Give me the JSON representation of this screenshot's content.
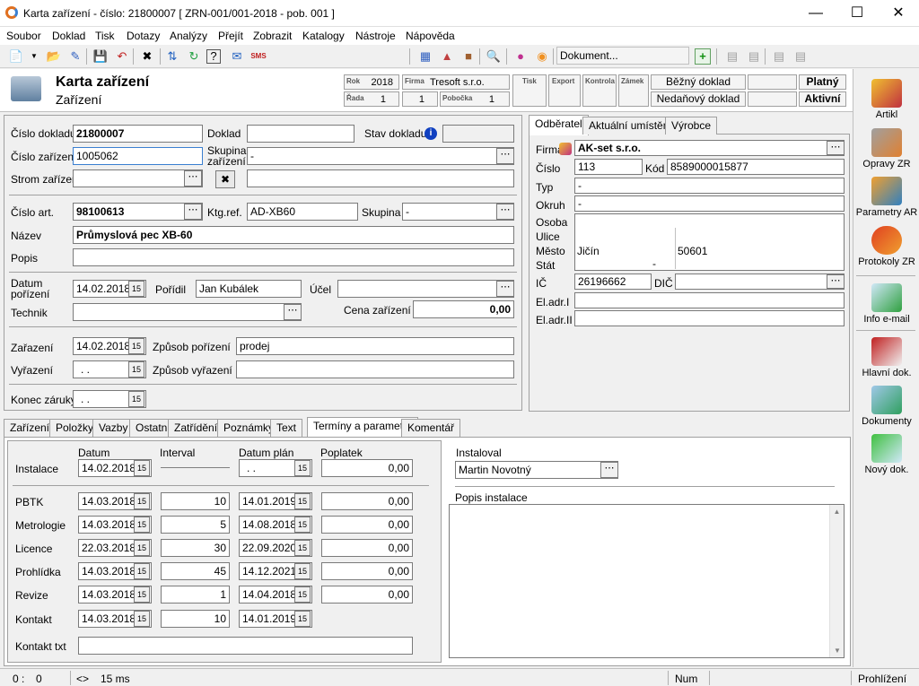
{
  "window": {
    "title": "Karta zařízení - číslo: 21800007  [ ZRN-001/001-2018 - pob. 001 ]"
  },
  "menu": [
    "Soubor",
    "Doklad",
    "Tisk",
    "Dotazy",
    "Analýzy",
    "Přejít",
    "Zobrazit",
    "Katalogy",
    "Nástroje",
    "Nápověda"
  ],
  "toolbar": {
    "document_field": "Dokument..."
  },
  "header": {
    "title": "Karta zařízení",
    "subtitle": "Zařízení",
    "rok_label": "Rok",
    "rok": "2018",
    "firma_label": "Firma",
    "firma": "Tresoft s.r.o.",
    "rada_label": "Řada",
    "rada": "1",
    "num1": "1",
    "pobocka_label": "Pobočka",
    "pobocka": "1",
    "tisk_label": "Tisk",
    "export_label": "Export",
    "kontrola_label": "Kontrola",
    "zamek_label": "Zámek",
    "doc_type1": "Běžný doklad",
    "doc_type2": "Nedaňový doklad",
    "status1": "Platný",
    "status2": "Aktivní"
  },
  "form": {
    "cislo_dokladu_label": "Číslo dokladu",
    "cislo_dokladu": "21800007",
    "doklad_label": "Doklad",
    "stav_dokladu_label": "Stav dokladu",
    "cislo_zarizeni_label": "Číslo zařízení",
    "cislo_zarizeni": "1005062",
    "skupina_zarizeni_label1": "Skupina",
    "skupina_zarizeni_label2": "zařízení",
    "skupina_zarizeni": "-",
    "strom_label": "Strom zařízení",
    "cislo_art_label": "Číslo art.",
    "cislo_art": "98100613",
    "ktg_label": "Ktg.ref.",
    "ktg": "AD-XB60",
    "skupina_label": "Skupina",
    "skupina": "-",
    "nazev_label": "Název",
    "nazev": "Průmyslová pec XB-60",
    "popis_label": "Popis",
    "datum_porizeni_label1": "Datum",
    "datum_porizeni_label2": "pořízení",
    "datum_porizeni": "14.02.2018",
    "poridil_label": "Pořídil",
    "poridil": "Jan Kubálek",
    "ucel_label": "Účel",
    "technik_label": "Technik",
    "cena_label": "Cena zařízení",
    "cena": "0,00",
    "zarazeni_label": "Zařazení",
    "zarazeni": "14.02.2018",
    "zpusob_porizeni_label": "Způsob pořízení",
    "zpusob_porizeni": "prodej",
    "vyrazeni_label": "Vyřazení",
    "vyrazeni": ". .",
    "zpusob_vyrazeni_label": "Způsob vyřazení",
    "konec_zaruky_label": "Konec záruky",
    "konec_zaruky": ". ."
  },
  "right_tabs": [
    "Odběratel",
    "Aktuální umístění",
    "Výrobce"
  ],
  "odberatel": {
    "firma_label": "Firma",
    "firma": "AK-set s.r.o.",
    "cislo_label": "Číslo",
    "cislo": "113",
    "kod_label": "Kód",
    "kod": "8589000015877",
    "typ_label": "Typ",
    "typ": "-",
    "okruh_label": "Okruh",
    "okruh": "-",
    "osoba_label": "Osoba",
    "ulice_label": "Ulice",
    "mesto_label": "Město",
    "mesto": "Jičín",
    "psc": "50601",
    "stat_label": "Stát",
    "stat": "-",
    "ic_label": "IČ",
    "ic": "26196662",
    "dic_label": "DIČ",
    "eladr1_label": "El.adr.I",
    "eladr2_label": "El.adr.II"
  },
  "bottom_tabs": [
    "Zařízení",
    "Položky",
    "Vazby",
    "Ostatní",
    "Zatřídění",
    "Poznámky",
    "Text",
    "Termíny a parametry",
    "Komentář"
  ],
  "terminy": {
    "col_datum": "Datum",
    "col_interval": "Interval",
    "col_datum_plan": "Datum plán",
    "col_poplatek": "Poplatek",
    "instalace": {
      "label": "Instalace",
      "datum": "14.02.2018",
      "plan": ". .",
      "poplatek": "0,00"
    },
    "rows": [
      {
        "label": "PBTK",
        "datum": "14.03.2018",
        "interval": "10",
        "plan": "14.01.2019",
        "poplatek": "0,00"
      },
      {
        "label": "Metrologie",
        "datum": "14.03.2018",
        "interval": "5",
        "plan": "14.08.2018",
        "poplatek": "0,00"
      },
      {
        "label": "Licence",
        "datum": "22.03.2018",
        "interval": "30",
        "plan": "22.09.2020",
        "poplatek": "0,00"
      },
      {
        "label": "Prohlídka",
        "datum": "14.03.2018",
        "interval": "45",
        "plan": "14.12.2021",
        "poplatek": "0,00"
      },
      {
        "label": "Revize",
        "datum": "14.03.2018",
        "interval": "1",
        "plan": "14.04.2018",
        "poplatek": "0,00"
      },
      {
        "label": "Kontakt",
        "datum": "14.03.2018",
        "interval": "10",
        "plan": "14.01.2019",
        "poplatek": ""
      }
    ],
    "kontakt_txt_label": "Kontakt txt",
    "instaloval_label": "Instaloval",
    "instaloval": "Martin Novotný",
    "popis_instalace_label": "Popis instalace"
  },
  "sidebar": [
    "Artikl",
    "Opravy ZR",
    "Parametry AR",
    "Protokoly ZR",
    "Info e-mail",
    "Hlavní dok.",
    "Dokumenty",
    "Nový dok."
  ],
  "status": {
    "pos1": "0 :",
    "pos2": "0",
    "arrows": "<>",
    "ms": "15 ms",
    "num": "Num",
    "mode": "Prohlížení"
  }
}
